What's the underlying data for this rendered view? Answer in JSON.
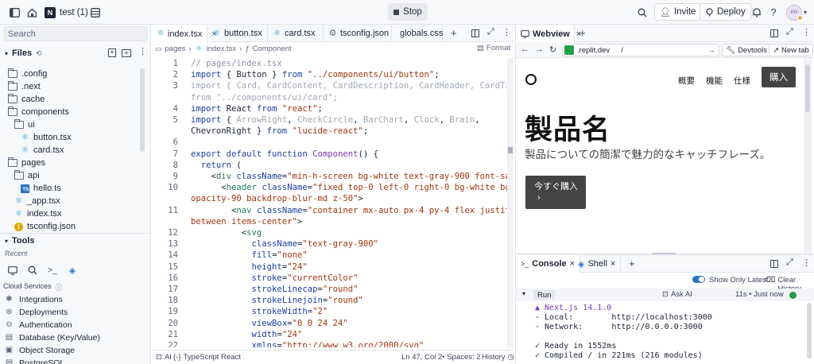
{
  "topbar": {
    "project_name": "test (1)",
    "project_badge": "N",
    "stop_label": "Stop",
    "invite_label": "Invite",
    "deploy_label": "Deploy",
    "avatar_initials": "KN"
  },
  "sidebar": {
    "search_placeholder": "Search",
    "files_label": "Files",
    "tree": [
      {
        "label": ".config",
        "type": "folder",
        "depth": 0
      },
      {
        "label": ".next",
        "type": "folder",
        "depth": 0
      },
      {
        "label": "cache",
        "type": "folder",
        "depth": 0
      },
      {
        "label": "components",
        "type": "folder",
        "depth": 0
      },
      {
        "label": "ui",
        "type": "folder",
        "depth": 1
      },
      {
        "label": "button.tsx",
        "type": "react",
        "depth": 2
      },
      {
        "label": "card.tsx",
        "type": "react",
        "depth": 2
      },
      {
        "label": "pages",
        "type": "folder",
        "depth": 0
      },
      {
        "label": "api",
        "type": "folder",
        "depth": 1
      },
      {
        "label": "hello.ts",
        "type": "ts",
        "depth": 2
      },
      {
        "label": "_app.tsx",
        "type": "react",
        "depth": 1
      },
      {
        "label": "index.tsx",
        "type": "react",
        "depth": 1
      },
      {
        "label": "tsconfig.json",
        "type": "json",
        "depth": 1
      }
    ],
    "tools_label": "Tools",
    "recent_label": "Recent",
    "cloud_label": "Cloud Services",
    "services": [
      "Integrations",
      "Deployments",
      "Authentication",
      "Database (Key/Value)",
      "Object Storage",
      "PostgreSQL"
    ]
  },
  "editor": {
    "tabs": [
      "index.tsx",
      "button.tsx",
      "card.tsx",
      "tsconfig.json",
      "globals.css"
    ],
    "breadcrumb": [
      "pages",
      "index.tsx",
      "Component"
    ],
    "format_label": "Format",
    "status": {
      "ai": "AI",
      "language": "TypeScript React",
      "position": "Ln 47, Col 2",
      "spaces": "Spaces: 2",
      "history": "History"
    }
  },
  "webview": {
    "tab_label": "Webview",
    "url_domain": ".replit.dev",
    "url_path": "/",
    "devtools_label": "Devtools",
    "newtab_label": "New tab",
    "site": {
      "nav": [
        "概要",
        "機能",
        "仕様"
      ],
      "buy_label": "購入",
      "heading": "製品名",
      "subheading": "製品についての簡潔で魅力的なキャッチフレーズ。",
      "cta_label": "今すぐ購入",
      "cta_arrow": "›"
    }
  },
  "console": {
    "tabs": [
      "Console",
      "Shell"
    ],
    "show_only_latest": "Show Only Latest",
    "clear_history": "Clear History",
    "run_label": "Run",
    "ask_ai": "Ask AI",
    "run_time": "11s • Just now",
    "lines": [
      "▲ Next.js 14.1.0",
      "- Local:        http://localhost:3000",
      "- Network:      http://0.0.0.0:3000",
      "",
      "✓ Ready in 1552ms",
      "✓ Compiled / in 221ms (216 modules)"
    ]
  },
  "code": [
    {
      "n": "1",
      "html": "<span class=\"cm\">// pages/index.tsx</span>"
    },
    {
      "n": "2",
      "html": "<span class=\"kw\">import</span> { Button } <span class=\"kw\">from</span> <span class=\"str\">\"../components/ui/button\"</span>;"
    },
    {
      "n": "3",
      "html": "<span class=\"dim\">import { Card, CardContent, CardDescription, CardHeader, CardTitle }</span>"
    },
    {
      "n": "",
      "html": "<span class=\"dim\">from \"../components/ui/card\";</span>"
    },
    {
      "n": "4",
      "html": "<span class=\"kw\">import</span> React <span class=\"kw\">from</span> <span class=\"str\">\"react\"</span>;"
    },
    {
      "n": "5",
      "html": "<span class=\"kw\">import</span> { <span class=\"dim\">ArrowRight</span>, <span class=\"dim\">CheckCircle</span>, <span class=\"dim\">BarChart</span>, <span class=\"dim\">Clock</span>, <span class=\"dim\">Brain</span>,"
    },
    {
      "n": "",
      "html": "ChevronRight } <span class=\"kw\">from</span> <span class=\"str\">\"lucide-react\"</span>;"
    },
    {
      "n": "6",
      "html": ""
    },
    {
      "n": "7",
      "html": "<span class=\"kw\">export default function</span> <span class=\"fn\">Component</span>() {"
    },
    {
      "n": "8",
      "html": "  <span class=\"kw\">return</span> ("
    },
    {
      "n": "9",
      "html": "    &lt;<span class=\"tag\">div</span> <span class=\"attr\">className</span>=<span class=\"str\">\"min-h-screen bg-white text-gray-900 font-sans\"</span>&gt;"
    },
    {
      "n": "10",
      "html": "      &lt;<span class=\"tag\">header</span> <span class=\"attr\">className</span>=<span class=\"str\">\"fixed top-0 left-0 right-0 bg-white bg-</span>"
    },
    {
      "n": "",
      "html": "<span class=\"str\">opacity-90 backdrop-blur-md z-50\"</span>&gt;"
    },
    {
      "n": "11",
      "html": "        &lt;<span class=\"tag\">nav</span> <span class=\"attr\">className</span>=<span class=\"str\">\"container mx-auto px-4 py-4 flex justify-</span>"
    },
    {
      "n": "",
      "html": "<span class=\"str\">between items-center\"</span>&gt;"
    },
    {
      "n": "12",
      "html": "          &lt;<span class=\"tag\">svg</span>"
    },
    {
      "n": "13",
      "html": "            <span class=\"attr\">className</span>=<span class=\"str\">\"text-gray-900\"</span>"
    },
    {
      "n": "14",
      "html": "            <span class=\"attr\">fill</span>=<span class=\"str\">\"none\"</span>"
    },
    {
      "n": "15",
      "html": "            <span class=\"attr\">height</span>=<span class=\"str\">\"24\"</span>"
    },
    {
      "n": "16",
      "html": "            <span class=\"attr\">stroke</span>=<span class=\"str\">\"currentColor\"</span>"
    },
    {
      "n": "17",
      "html": "            <span class=\"attr\">strokeLinecap</span>=<span class=\"str\">\"round\"</span>"
    },
    {
      "n": "18",
      "html": "            <span class=\"attr\">strokeLinejoin</span>=<span class=\"str\">\"round\"</span>"
    },
    {
      "n": "19",
      "html": "            <span class=\"attr\">strokeWidth</span>=<span class=\"str\">\"2\"</span>"
    },
    {
      "n": "20",
      "html": "            <span class=\"attr\">viewBox</span>=<span class=\"str\">\"0 0 24 24\"</span>"
    },
    {
      "n": "21",
      "html": "            <span class=\"attr\">width</span>=<span class=\"str\">\"24\"</span>"
    },
    {
      "n": "22",
      "html": "            <span class=\"attr\">xmlns</span>=<span class=\"str\">\"http://www.w3.org/2000/svg\"</span>"
    }
  ]
}
